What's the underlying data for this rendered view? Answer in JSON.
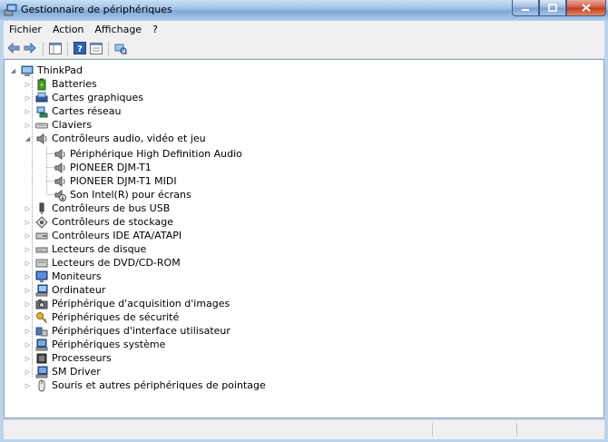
{
  "window": {
    "title": "Gestionnaire de périphériques"
  },
  "menu": [
    "Fichier",
    "Action",
    "Affichage",
    "?"
  ],
  "tree": {
    "root": "ThinkPad",
    "categories": [
      {
        "label": "Batteries",
        "icon": "battery-icon",
        "color": "#3c9a2e"
      },
      {
        "label": "Cartes graphiques",
        "icon": "display-adapter-icon",
        "color": "#2c5aa0"
      },
      {
        "label": "Cartes réseau",
        "icon": "network-adapter-icon",
        "color": "#2e8b57"
      },
      {
        "label": "Claviers",
        "icon": "keyboard-icon",
        "color": "#808080"
      },
      {
        "label": "Contrôleurs audio, vidéo et jeu",
        "icon": "speaker-icon",
        "color": "#707070",
        "expanded": true,
        "children": [
          {
            "label": "Périphérique High Definition Audio",
            "icon": "speaker-icon"
          },
          {
            "label": "PIONEER DJM-T1",
            "icon": "speaker-icon"
          },
          {
            "label": "PIONEER DJM-T1 MIDI",
            "icon": "speaker-icon"
          },
          {
            "label": "Son Intel(R) pour écrans",
            "icon": "speaker-warning-icon"
          }
        ]
      },
      {
        "label": "Contrôleurs de bus USB",
        "icon": "usb-icon",
        "color": "#555555"
      },
      {
        "label": "Contrôleurs de stockage",
        "icon": "storage-controller-icon",
        "color": "#555555"
      },
      {
        "label": "Contrôleurs IDE ATA/ATAPI",
        "icon": "ide-controller-icon",
        "color": "#5a8a5a"
      },
      {
        "label": "Lecteurs de disque",
        "icon": "disk-drive-icon",
        "color": "#8a8a8a"
      },
      {
        "label": "Lecteurs de DVD/CD-ROM",
        "icon": "dvd-drive-icon",
        "color": "#8a8a8a"
      },
      {
        "label": "Moniteurs",
        "icon": "monitor-icon",
        "color": "#2c5aa0"
      },
      {
        "label": "Ordinateur",
        "icon": "computer-icon",
        "color": "#2c5aa0"
      },
      {
        "label": "Périphérique d'acquisition d'images",
        "icon": "camera-icon",
        "color": "#606060"
      },
      {
        "label": "Périphériques de sécurité",
        "icon": "key-icon",
        "color": "#c9a227"
      },
      {
        "label": "Périphériques d'interface utilisateur",
        "icon": "hid-icon",
        "color": "#4a7bb5"
      },
      {
        "label": "Périphériques système",
        "icon": "system-device-icon",
        "color": "#2c5aa0"
      },
      {
        "label": "Processeurs",
        "icon": "processor-icon",
        "color": "#404040"
      },
      {
        "label": "SM Driver",
        "icon": "driver-icon",
        "color": "#2c5aa0"
      },
      {
        "label": "Souris et autres périphériques de pointage",
        "icon": "mouse-icon",
        "color": "#888888"
      }
    ]
  }
}
